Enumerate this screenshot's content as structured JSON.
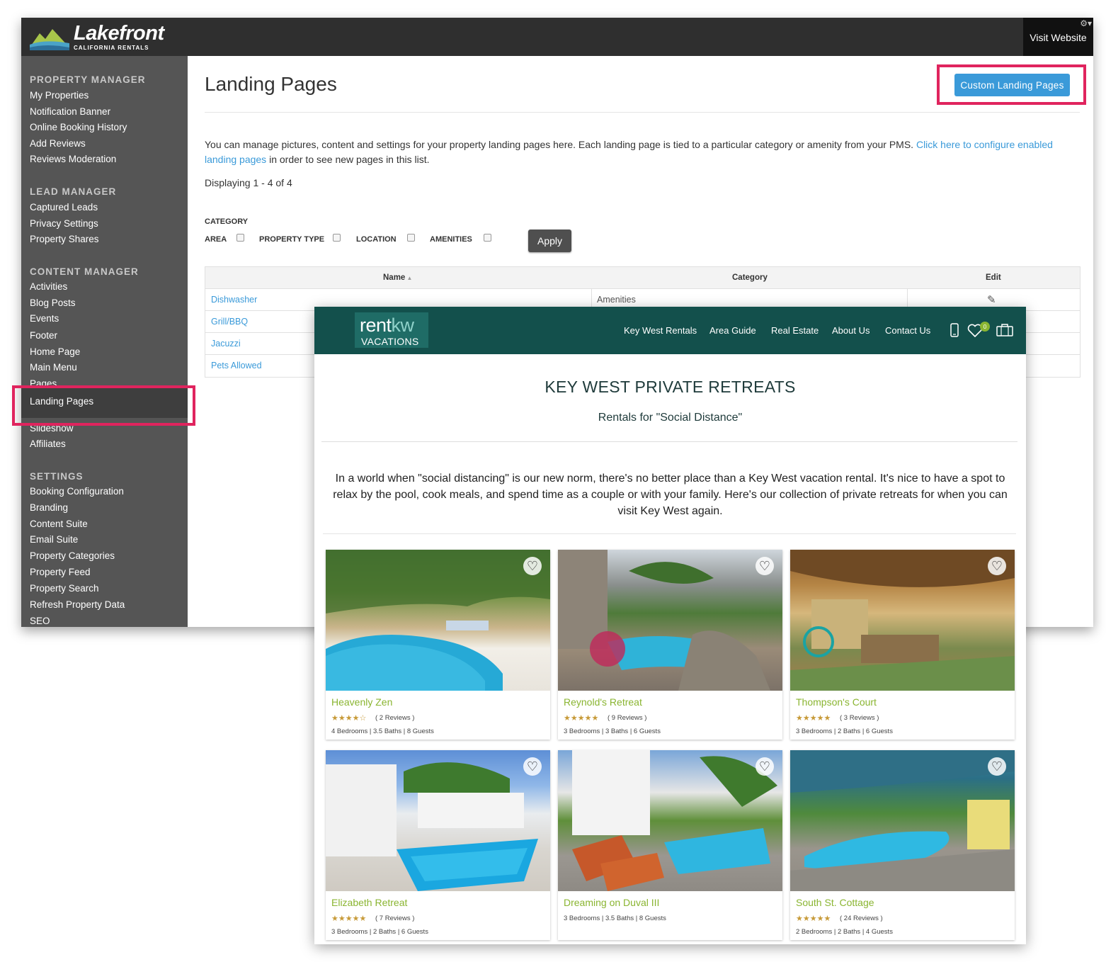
{
  "admin": {
    "brand": {
      "name": "Lakefront",
      "sub": "CALIFORNIA RENTALS"
    },
    "visit_website": "Visit Website",
    "sidebar": {
      "sections": [
        {
          "title": "PROPERTY MANAGER",
          "items": [
            "My Properties",
            "Notification Banner",
            "Online Booking History",
            "Add Reviews",
            "Reviews Moderation"
          ]
        },
        {
          "title": "LEAD MANAGER",
          "items": [
            "Captured Leads",
            "Privacy Settings",
            "Property Shares"
          ]
        },
        {
          "title": "CONTENT MANAGER",
          "items": [
            "Activities",
            "Blog Posts",
            "Events",
            "Footer",
            "Home Page",
            "Main Menu",
            "Pages",
            "Landing Pages",
            "Slideshow",
            "Affiliates"
          ]
        },
        {
          "title": "SETTINGS",
          "items": [
            "Booking Configuration",
            "Branding",
            "Content Suite",
            "Email Suite",
            "Property Categories",
            "Property Feed",
            "Property Search",
            "Refresh Property Data",
            "SEO"
          ]
        }
      ],
      "active": "Landing Pages"
    },
    "main": {
      "title": "Landing Pages",
      "custom_button": "Custom Landing Pages",
      "intro_text": "You can manage pictures, content and settings for your property landing pages here. Each landing page is tied to a particular category or amenity from your PMS.",
      "intro_link": "Click here to configure enabled landing pages",
      "intro_tail": "in order to see new pages in this list.",
      "displaying": "Displaying 1 - 4 of 4",
      "filters": {
        "category_label": "CATEGORY",
        "options": [
          "AREA",
          "PROPERTY TYPE",
          "LOCATION",
          "AMENITIES"
        ],
        "apply": "Apply"
      },
      "table": {
        "headers": {
          "name": "Name",
          "category": "Category",
          "edit": "Edit"
        },
        "rows": [
          {
            "name": "Dishwasher",
            "category": "Amenities"
          },
          {
            "name": "Grill/BBQ",
            "category": ""
          },
          {
            "name": "Jacuzzi",
            "category": ""
          },
          {
            "name": "Pets Allowed",
            "category": ""
          }
        ]
      }
    }
  },
  "site": {
    "logo": {
      "line1_a": "rent",
      "line1_b": "kw",
      "line2": "VACATIONS"
    },
    "nav": [
      "Key West Rentals",
      "Area Guide",
      "Real Estate",
      "About Us",
      "Contact Us"
    ],
    "favorites_count": "0",
    "icons": [
      "phone-icon",
      "heart-icon",
      "luggage-icon"
    ],
    "title": "KEY WEST PRIVATE RETREATS",
    "subtitle": "Rentals for \"Social Distance\"",
    "description": "In a world when \"social distancing\" is our new norm, there's no better place than a Key West vacation rental. It's nice to have a spot to relax by the pool, cook meals, and spend time as a couple or with your family. Here's our collection of private retreats for when you can visit Key West again.",
    "accent_color": "#8ab531",
    "nav_color": "#13504c",
    "listings": [
      {
        "name": "Heavenly Zen",
        "stars": "★★★★☆",
        "reviews": "( 2 Reviews )",
        "details": "4 Bedrooms | 3.5 Baths | 8 Guests"
      },
      {
        "name": "Reynold's Retreat",
        "stars": "★★★★★",
        "reviews": "( 9 Reviews )",
        "details": "3 Bedrooms | 3 Baths | 6 Guests"
      },
      {
        "name": "Thompson's Court",
        "stars": "★★★★★",
        "reviews": "( 3 Reviews )",
        "details": "3 Bedrooms | 2 Baths | 6 Guests"
      },
      {
        "name": "Elizabeth Retreat",
        "stars": "★★★★★",
        "reviews": "( 7 Reviews )",
        "details": "3 Bedrooms | 2 Baths | 6 Guests"
      },
      {
        "name": "Dreaming on Duval III",
        "stars": "",
        "reviews": "",
        "details": "3 Bedrooms | 3.5 Baths | 8 Guests"
      },
      {
        "name": "South St. Cottage",
        "stars": "★★★★★",
        "reviews": "( 24 Reviews )",
        "details": "2 Bedrooms | 2 Baths | 4 Guests"
      }
    ]
  }
}
